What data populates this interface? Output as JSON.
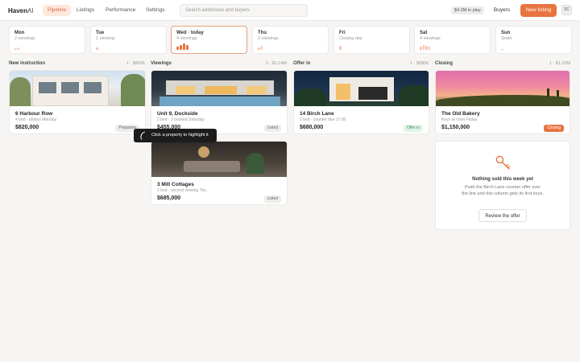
{
  "brand": {
    "name": "Haven",
    "suffix": "AI"
  },
  "nav": {
    "tabs": [
      "Pipeline",
      "Listings",
      "Performance",
      "Settings"
    ],
    "active": "Pipeline"
  },
  "search": {
    "placeholder": "Search addresses and buyers"
  },
  "header": {
    "in_play": "$4.2M in play",
    "buyers": "Buyers",
    "new_listing": "New listing",
    "avatar": "SC"
  },
  "days": [
    {
      "name": "Mon",
      "count": "2 viewings",
      "bars": [
        2,
        3
      ]
    },
    {
      "name": "Tue",
      "count": "1 viewing",
      "bars": [
        3
      ]
    },
    {
      "name": "Wed · today",
      "count": "4 viewings",
      "bars": [
        4,
        6,
        8,
        6
      ]
    },
    {
      "name": "Thu",
      "count": "2 viewings",
      "bars": [
        3,
        5
      ]
    },
    {
      "name": "Fri",
      "count": "Closing day",
      "bars": [
        5
      ]
    },
    {
      "name": "Sat",
      "count": "4 viewings",
      "bars": [
        4,
        6,
        5,
        4
      ]
    },
    {
      "name": "Sun",
      "count": "Quiet",
      "bars": [
        1
      ]
    }
  ],
  "columns": [
    {
      "title": "New instruction",
      "meta": "1 · $820k"
    },
    {
      "title": "Viewings",
      "meta": "2 · $1.14M"
    },
    {
      "title": "Offer in",
      "meta": "1 · $680k"
    },
    {
      "title": "Closing",
      "meta": "1 · $1.15M"
    }
  ],
  "cards": {
    "harbour": {
      "title": "6 Harbour Row",
      "sub": "4 bed · photos Monday",
      "price": "$820,000",
      "status": "Preparing"
    },
    "dockside": {
      "title": "Unit 9, Dockside",
      "sub": "2 bed · 3 booked Saturday",
      "price": "$455,000",
      "status": "Listed"
    },
    "mill": {
      "title": "3 Mill Cottages",
      "sub": "2 bed · second viewing Thu",
      "price": "$685,000",
      "status": "Listed"
    },
    "birch": {
      "title": "14 Birch Lane",
      "sub": "3 bed · counter due 17:00",
      "price": "$680,000",
      "status": "Offer in"
    },
    "bakery": {
      "title": "The Old Bakery",
      "sub": "Keys at noon Friday",
      "price": "$1,150,000",
      "status": "Closing"
    }
  },
  "tooltip": {
    "text": "Click a property to highlight it"
  },
  "empty": {
    "title": "Nothing sold this week yet",
    "body": "Push the Birch Lane counter offer over the line and this column gets its first keys.",
    "button": "Review the offer"
  },
  "colors": {
    "accent": "#e8743f",
    "accent_soft": "#fde8dd",
    "success": "#3a9a5b"
  }
}
